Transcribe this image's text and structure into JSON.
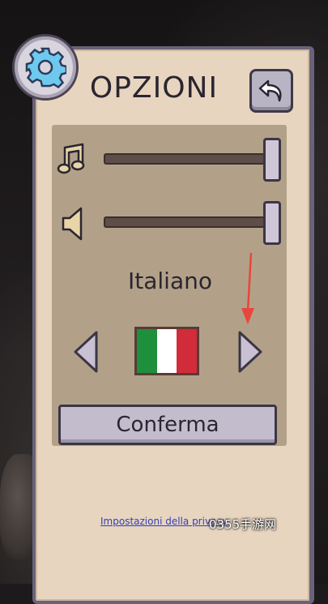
{
  "header": {
    "title": "OPZIONI",
    "settings_icon": "gear-icon",
    "back_icon": "back-arrow-icon"
  },
  "audio": {
    "music_icon": "music-note-icon",
    "music_volume": 1.0,
    "sound_icon": "speaker-icon",
    "sound_volume": 1.0
  },
  "language": {
    "current": "Italiano",
    "flag": "italy-flag",
    "flag_colors": [
      "#1e8f3a",
      "#ffffff",
      "#d22b3a"
    ],
    "prev_icon": "chevron-left-icon",
    "next_icon": "chevron-right-icon"
  },
  "actions": {
    "confirm_label": "Conferma"
  },
  "footer": {
    "privacy_link": "Impostazioni della privacy",
    "watermark": "0355手游网"
  },
  "colors": {
    "panel": "#e8d5bf",
    "inner_panel": "#b2a188",
    "button": "#c3bccd",
    "border": "#3b3645",
    "link": "#2f3fbf",
    "annotation_arrow": "#e8463c"
  }
}
